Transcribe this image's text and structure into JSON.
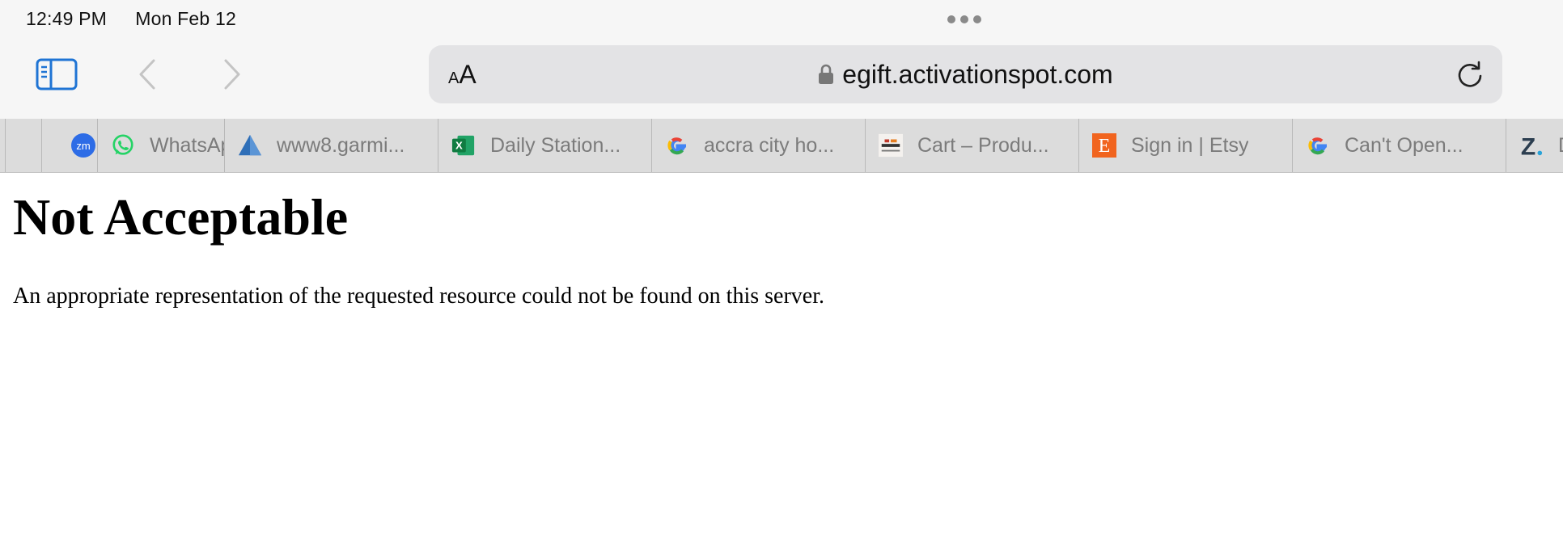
{
  "status_bar": {
    "time": "12:49 PM",
    "date": "Mon Feb 12"
  },
  "toolbar": {
    "reader_label_small": "A",
    "reader_label_large": "A",
    "url": "egift.activationspot.com",
    "icons": {
      "sidebar": "sidebar-icon",
      "back": "chevron-left-icon",
      "forward": "chevron-right-icon",
      "lock": "lock-icon",
      "reload": "reload-icon"
    }
  },
  "tabs": [
    {
      "title": "",
      "favicon": "blank"
    },
    {
      "title": "",
      "favicon": "zoom-icon"
    },
    {
      "title": "WhatsApp",
      "favicon": "whatsapp-icon"
    },
    {
      "title": "www8.garmi...",
      "favicon": "garmin-icon"
    },
    {
      "title": "Daily Station...",
      "favicon": "excel-icon"
    },
    {
      "title": "accra city ho...",
      "favicon": "google-icon"
    },
    {
      "title": "Cart – Produ...",
      "favicon": "shop-icon"
    },
    {
      "title": "Sign in | Etsy",
      "favicon": "etsy-icon"
    },
    {
      "title": "Can't Open...",
      "favicon": "google-icon"
    },
    {
      "title": "D",
      "favicon": "z-logo-icon"
    }
  ],
  "page": {
    "heading": "Not Acceptable",
    "body": "An appropriate representation of the requested resource could not be found on this server."
  },
  "colors": {
    "chrome": "#f6f6f6",
    "address_bar": "#e3e3e5",
    "tab_bar": "#dcdcdc",
    "accent_blue": "#1f74d4"
  }
}
